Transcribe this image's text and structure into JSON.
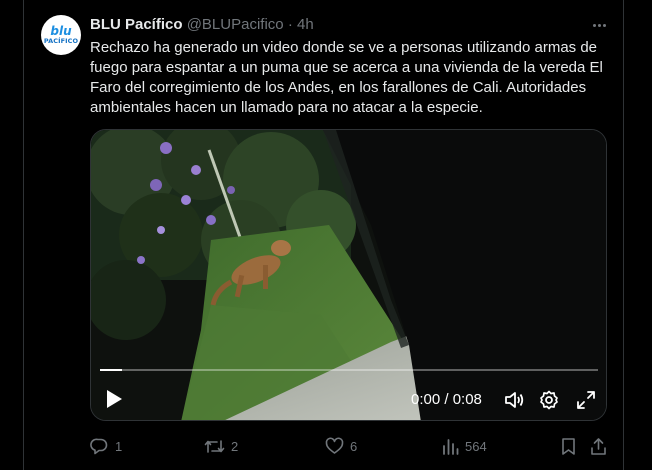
{
  "tweet": {
    "author_name": "BLU Pacífico",
    "handle": "@BLUPacifico",
    "separator": "·",
    "time": "4h",
    "avatar_line1": "blu",
    "avatar_line2": "PACÍFICO",
    "text": "Rechazo ha generado un video donde se ve a personas utilizando armas de fuego para espantar a un puma que se acerca a una vivienda de la vereda El Faro del corregimiento de los Andes, en los farallones de Cali. Autoridades ambientales hacen un llamado para no atacar a la especie."
  },
  "video": {
    "current_time": "0:00",
    "duration": "0:08",
    "time_display": "0:00 / 0:08",
    "progress_fraction": 0.045
  },
  "actions": {
    "replies": "1",
    "reposts": "2",
    "likes": "6",
    "views": "564"
  },
  "icons": {
    "more": "more-icon",
    "play": "play-icon",
    "volume": "volume-icon",
    "settings": "settings-icon",
    "fullscreen": "fullscreen-icon",
    "reply": "reply-icon",
    "repost": "repost-icon",
    "like": "like-icon",
    "views": "views-icon",
    "bookmark": "bookmark-icon",
    "share": "share-icon"
  },
  "colors": {
    "background": "#000000",
    "text": "#e7e9ea",
    "secondary": "#71767b",
    "border": "#2f3336"
  }
}
